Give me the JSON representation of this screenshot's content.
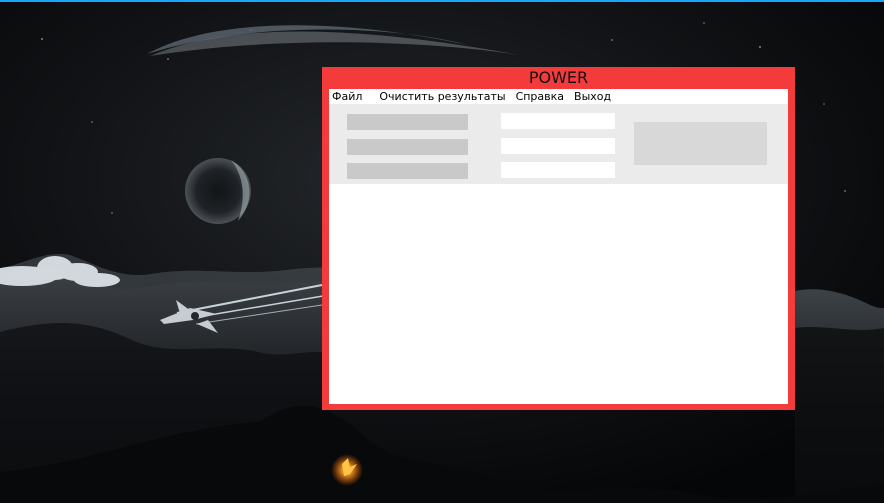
{
  "window": {
    "title": "POWER"
  },
  "menu": {
    "items": [
      "Файл",
      "Очистить результаты",
      "Справка",
      "Выход"
    ]
  },
  "colors": {
    "window_frame": "#f43b3b",
    "panel": "#ebebeb",
    "button": "#c9c9c9",
    "result_box": "#d8d8d8",
    "desktop_accent_border": "#1aa3ff"
  },
  "controls": {
    "button_count": 3,
    "field_count": 3
  }
}
